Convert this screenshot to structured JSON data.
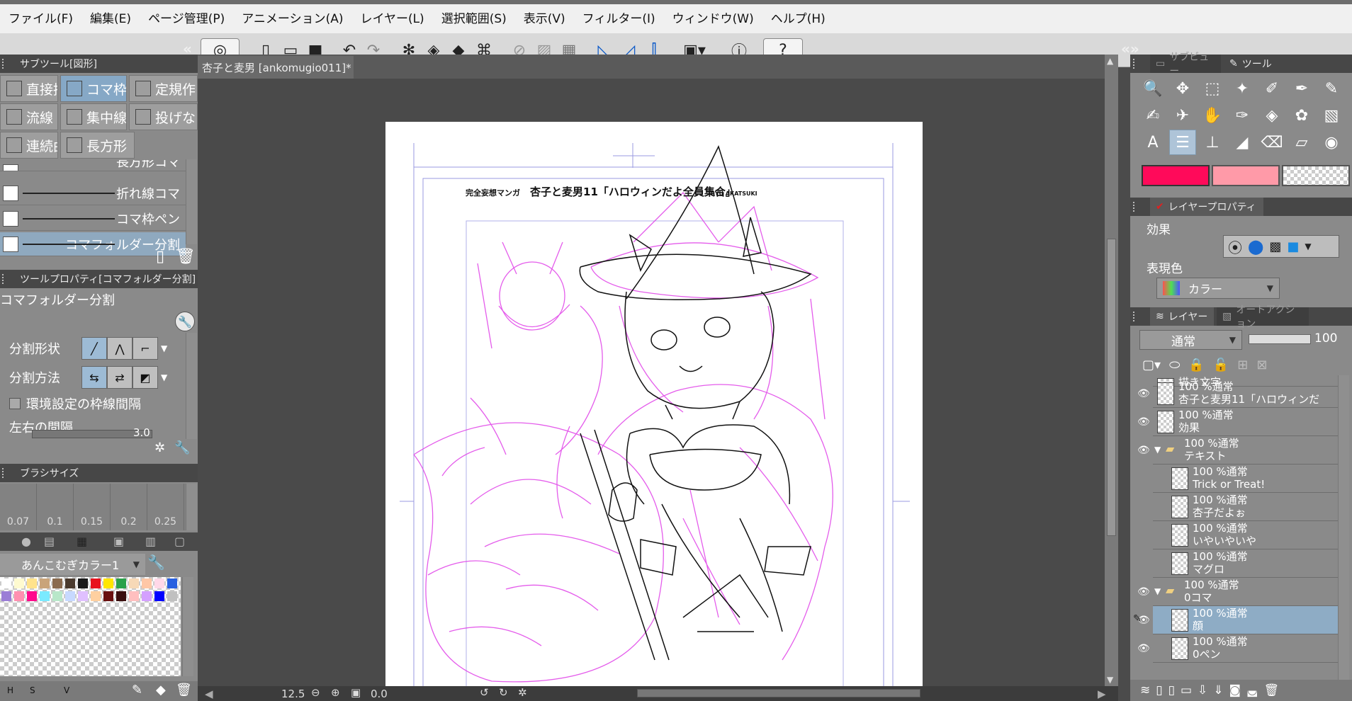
{
  "menu": [
    "ファイル(F)",
    "編集(E)",
    "ページ管理(P)",
    "アニメーション(A)",
    "レイヤー(L)",
    "選択範囲(S)",
    "表示(V)",
    "フィルター(I)",
    "ウィンドウ(W)",
    "ヘルプ(H)"
  ],
  "panels": {
    "subtool_title": "サブツール[図形]",
    "tool_property_title": "ツールプロパティ[コマフォルダー分割]",
    "brush_size_title": "ブラシサイズ",
    "navigator_title": "サブビュー",
    "tool_title": "ツール",
    "layer_property_title": "レイヤープロパティ",
    "layer_title": "レイヤー",
    "auto_action_title": "オートアクション"
  },
  "subtool": {
    "groups": [
      "直接描",
      "コマ枠",
      "定規作",
      "流線",
      "集中線",
      "投げな",
      "連続曲",
      "長方形"
    ],
    "brushes": [
      "長方形コマ",
      "折れ線コマ",
      "コマ枠ペン",
      "コマフォルダー分割"
    ],
    "selected_brush": "コマフォルダー分割"
  },
  "tool_property": {
    "name": "コマフォルダー分割",
    "split_shape_label": "分割形状",
    "split_method_label": "分割方法",
    "env_checkbox_label": "環境設定の枠線間隔",
    "lr_spacing_label": "左右の間隔",
    "lr_spacing_value": "3.0"
  },
  "brush_size": {
    "values": [
      "0.07",
      "0.1",
      "0.15",
      "0.2",
      "0.25"
    ]
  },
  "color_set": {
    "name": "あんこむぎカラー1",
    "swatches": [
      "#ffffff",
      "#fffbd0",
      "#ffe38c",
      "#c9a47a",
      "#8a6b4f",
      "#4a3a2e",
      "#1a1a1a",
      "#e8131e",
      "#ffe600",
      "#2aa14b",
      "#f7d9b7",
      "#ffc7a6",
      "#ffd8e8",
      "#2860e0",
      "#9b7ed6",
      "#ff90b0",
      "#ff0a8c",
      "#7aeaff",
      "#b8e7c9",
      "#c7d9ff",
      "#e0c0ff",
      "#ffd0a0",
      "#6a1010",
      "#3a0e0e",
      "#ffbfbf",
      "#d4a0ff",
      "#0000ff",
      "#c0c0c0"
    ]
  },
  "document": {
    "tab_title": "杏子と麦男 [ankomugio011]*",
    "manga_series": "完全妄想マンガ",
    "manga_title": "杏子と麦男11「ハロウィンだよ全員集合」",
    "author": "RYU AKATSUKI"
  },
  "status": {
    "zoom": "12.5",
    "angle": "0.0"
  },
  "colors": {
    "main": "#ff0a5a",
    "sub": "#ff9aa8",
    "sketch": "#e040e8"
  },
  "layer_property": {
    "effect_label": "効果",
    "expression_label": "表現色",
    "expression_value": "カラー"
  },
  "layers_panel": {
    "blend_mode": "通常",
    "opacity": "100"
  },
  "layers": [
    {
      "line1": "描き文字",
      "line2": "",
      "indent": 0,
      "folder": false,
      "visible": false,
      "selected": false
    },
    {
      "line1": "100 %通常",
      "line2": "杏子と麦男11「ハロウィンだ",
      "indent": 0,
      "folder": false,
      "visible": true,
      "selected": false
    },
    {
      "line1": "100 %通常",
      "line2": "効果",
      "indent": 0,
      "folder": false,
      "visible": true,
      "selected": false
    },
    {
      "line1": "100 %通常",
      "line2": "テキスト",
      "indent": 0,
      "folder": true,
      "visible": true,
      "selected": false
    },
    {
      "line1": "100 %通常",
      "line2": "Trick or Treat!",
      "indent": 1,
      "folder": false,
      "visible": false,
      "selected": false
    },
    {
      "line1": "100 %通常",
      "line2": "杏子だよぉ",
      "indent": 1,
      "folder": false,
      "visible": false,
      "selected": false
    },
    {
      "line1": "100 %通常",
      "line2": "いやいやいや",
      "indent": 1,
      "folder": false,
      "visible": false,
      "selected": false
    },
    {
      "line1": "100 %通常",
      "line2": "マグロ",
      "indent": 1,
      "folder": false,
      "visible": false,
      "selected": false
    },
    {
      "line1": "100 %通常",
      "line2": "0コマ",
      "indent": 0,
      "folder": true,
      "visible": true,
      "selected": false
    },
    {
      "line1": "100 %通常",
      "line2": "顔",
      "indent": 1,
      "folder": false,
      "visible": true,
      "selected": true
    },
    {
      "line1": "100 %通常",
      "line2": "0ペン",
      "indent": 1,
      "folder": false,
      "visible": true,
      "selected": false
    }
  ]
}
